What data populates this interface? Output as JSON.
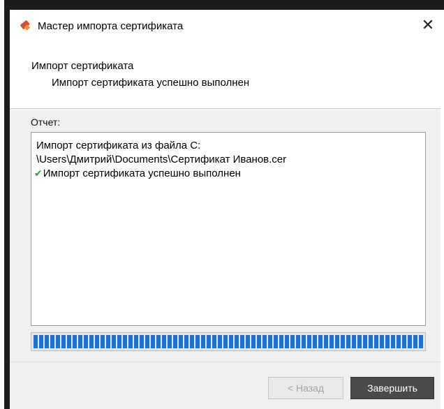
{
  "window": {
    "title": "Мастер импорта сертификата",
    "close_symbol": "✕",
    "icon": "certificate-icon"
  },
  "header": {
    "title": "Импорт сертификата",
    "subtitle": "Импорт сертификата успешно выполнен"
  },
  "report": {
    "label": "Отчет:",
    "lines": [
      "Импорт сертификата из файла C:",
      "\\Users\\Дмитрий\\Documents\\Сертификат Иванов.cer",
      "Импорт сертификата успешно выполнен"
    ],
    "success_icon": "check-icon",
    "check_symbol": "✔"
  },
  "progress": {
    "value": 1.0
  },
  "buttons": {
    "back_label": "< Назад",
    "finish_label": "Завершить"
  },
  "colors": {
    "progress": "#1a74d6",
    "check": "#2e9e3a",
    "finish_button": "#4a4a4a"
  }
}
